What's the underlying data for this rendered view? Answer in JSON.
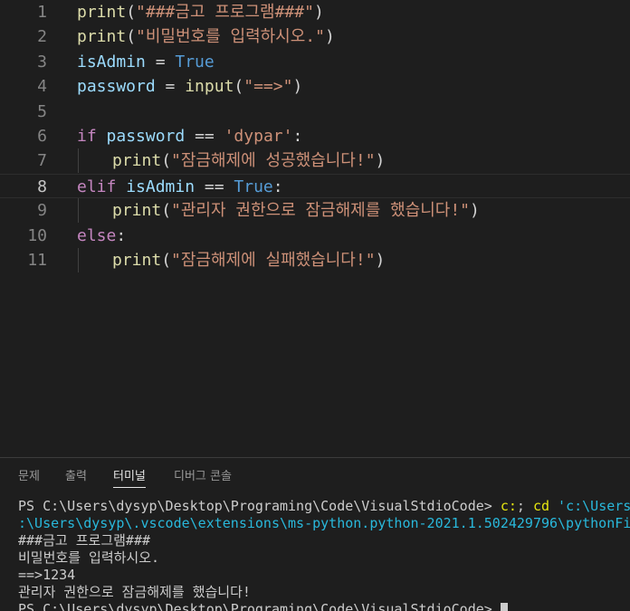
{
  "editor": {
    "lines": [
      {
        "num": "1",
        "parts": [
          [
            "fn",
            "print"
          ],
          [
            "op",
            "("
          ],
          [
            "str",
            "\"###금고 프로그램###\""
          ],
          [
            "op",
            ")"
          ]
        ]
      },
      {
        "num": "2",
        "parts": [
          [
            "fn",
            "print"
          ],
          [
            "op",
            "("
          ],
          [
            "str",
            "\"비밀번호를 입력하시오.\""
          ],
          [
            "op",
            ")"
          ]
        ]
      },
      {
        "num": "3",
        "parts": [
          [
            "var",
            "isAdmin"
          ],
          [
            "op",
            " = "
          ],
          [
            "bool",
            "True"
          ]
        ]
      },
      {
        "num": "4",
        "parts": [
          [
            "var",
            "password"
          ],
          [
            "op",
            " = "
          ],
          [
            "fn",
            "input"
          ],
          [
            "op",
            "("
          ],
          [
            "str",
            "\"==>\""
          ],
          [
            "op",
            ")"
          ]
        ]
      },
      {
        "num": "5",
        "parts": []
      },
      {
        "num": "6",
        "parts": [
          [
            "kw",
            "if"
          ],
          [
            "op",
            " "
          ],
          [
            "var",
            "password"
          ],
          [
            "op",
            " == "
          ],
          [
            "str",
            "'dypar'"
          ],
          [
            "op",
            ":"
          ]
        ]
      },
      {
        "num": "7",
        "indent": true,
        "parts": [
          [
            "fn",
            "print"
          ],
          [
            "op",
            "("
          ],
          [
            "str",
            "\"잠금해제에 성공했습니다!\""
          ],
          [
            "op",
            ")"
          ]
        ]
      },
      {
        "num": "8",
        "current": true,
        "parts": [
          [
            "kw",
            "elif"
          ],
          [
            "op",
            " "
          ],
          [
            "var",
            "isAdmin"
          ],
          [
            "op",
            " == "
          ],
          [
            "bool",
            "True"
          ],
          [
            "op",
            ":"
          ]
        ]
      },
      {
        "num": "9",
        "indent": true,
        "parts": [
          [
            "fn",
            "print"
          ],
          [
            "op",
            "("
          ],
          [
            "str",
            "\"관리자 권한으로 잠금해제를 했습니다!\""
          ],
          [
            "op",
            ")"
          ]
        ]
      },
      {
        "num": "10",
        "parts": [
          [
            "kw",
            "else"
          ],
          [
            "op",
            ":"
          ]
        ]
      },
      {
        "num": "11",
        "indent": true,
        "parts": [
          [
            "fn",
            "print"
          ],
          [
            "op",
            "("
          ],
          [
            "str",
            "\"잠금해제에 실패했습니다!\""
          ],
          [
            "op",
            ")"
          ]
        ]
      }
    ]
  },
  "panel": {
    "tabs": [
      {
        "label": "문제",
        "active": false
      },
      {
        "label": "출력",
        "active": false
      },
      {
        "label": "터미널",
        "active": true
      },
      {
        "label": "디버그 콘솔",
        "active": false
      }
    ]
  },
  "terminal": {
    "lines": [
      [
        [
          "plain",
          "PS C:\\Users\\dysyp\\Desktop\\Programing\\Code\\VisualStdioCode> "
        ],
        [
          "yellow",
          "c:"
        ],
        [
          "plain",
          "; "
        ],
        [
          "yellow",
          "cd "
        ],
        [
          "cyan",
          "'c:\\Users\\dysyp\\Desktop\\Programing\\Code\\VisualStdioCode'"
        ]
      ],
      [
        [
          "cyan",
          ":\\Users\\dysyp\\.vscode\\extensions\\ms-python.python-2021.1.502429796\\pythonFiles\\lib\\python\\debugpy\\launcher'"
        ]
      ],
      [
        [
          "plain",
          "###금고 프로그램###"
        ]
      ],
      [
        [
          "plain",
          "비밀번호를 입력하시오."
        ]
      ],
      [
        [
          "plain",
          "==>1234"
        ]
      ],
      [
        [
          "plain",
          "관리자 권한으로 잠금해제를 했습니다!"
        ]
      ],
      [
        [
          "plain",
          "PS C:\\Users\\dysyp\\Desktop\\Programing\\Code\\VisualStdioCode> "
        ],
        [
          "cursor",
          ""
        ]
      ]
    ]
  }
}
